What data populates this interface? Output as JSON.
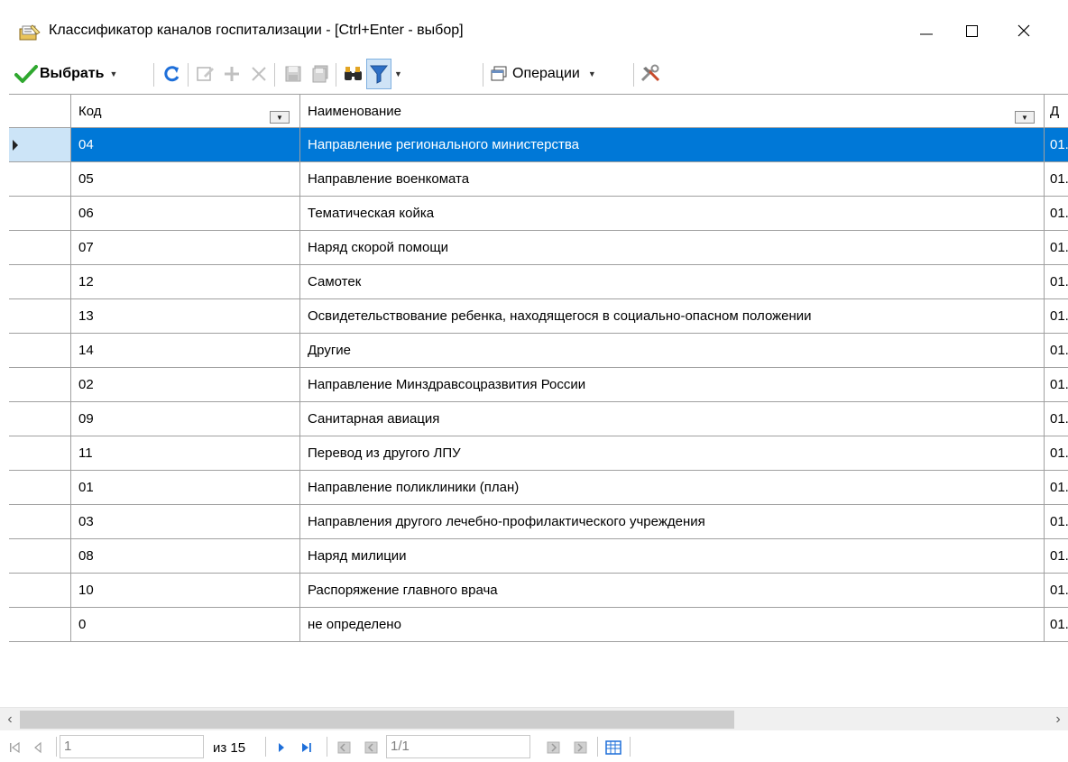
{
  "window": {
    "title": "Классификатор каналов госпитализации - [Ctrl+Enter - выбор]",
    "icon": "classifier-window-icon"
  },
  "toolbar": {
    "select_label": "Выбрать",
    "operations_label": "Операции"
  },
  "grid": {
    "columns": [
      {
        "label": "Код"
      },
      {
        "label": "Наименование"
      },
      {
        "label": "Д"
      }
    ],
    "rows": [
      {
        "code": "04",
        "name": "Направление регионального министерства",
        "date": "01."
      },
      {
        "code": "05",
        "name": "Направление военкомата",
        "date": "01."
      },
      {
        "code": "06",
        "name": "Тематическая койка",
        "date": "01."
      },
      {
        "code": "07",
        "name": "Наряд скорой помощи",
        "date": "01."
      },
      {
        "code": "12",
        "name": "Самотек",
        "date": "01."
      },
      {
        "code": "13",
        "name": "Освидетельствование ребенка, находящегося в социально-опасном положении",
        "date": "01."
      },
      {
        "code": "14",
        "name": "Другие",
        "date": "01."
      },
      {
        "code": "02",
        "name": "Направление Минздравсоцразвития России",
        "date": "01."
      },
      {
        "code": "09",
        "name": "Санитарная авиация",
        "date": "01."
      },
      {
        "code": "11",
        "name": "Перевод из другого ЛПУ",
        "date": "01."
      },
      {
        "code": "01",
        "name": "Направление поликлиники (план)",
        "date": "01."
      },
      {
        "code": "03",
        "name": "Направления другого лечебно-профилактического учреждения",
        "date": "01."
      },
      {
        "code": "08",
        "name": "Наряд милиции",
        "date": "01."
      },
      {
        "code": "10",
        "name": "Распоряжение главного врача",
        "date": "01."
      },
      {
        "code": "0",
        "name": "не определено",
        "date": "01."
      }
    ]
  },
  "navigator": {
    "record_value": "1",
    "total_label": "из 15",
    "page_value": "1/1"
  },
  "colors": {
    "selection": "#0078d7",
    "accent_blue": "#1e6fd9"
  }
}
